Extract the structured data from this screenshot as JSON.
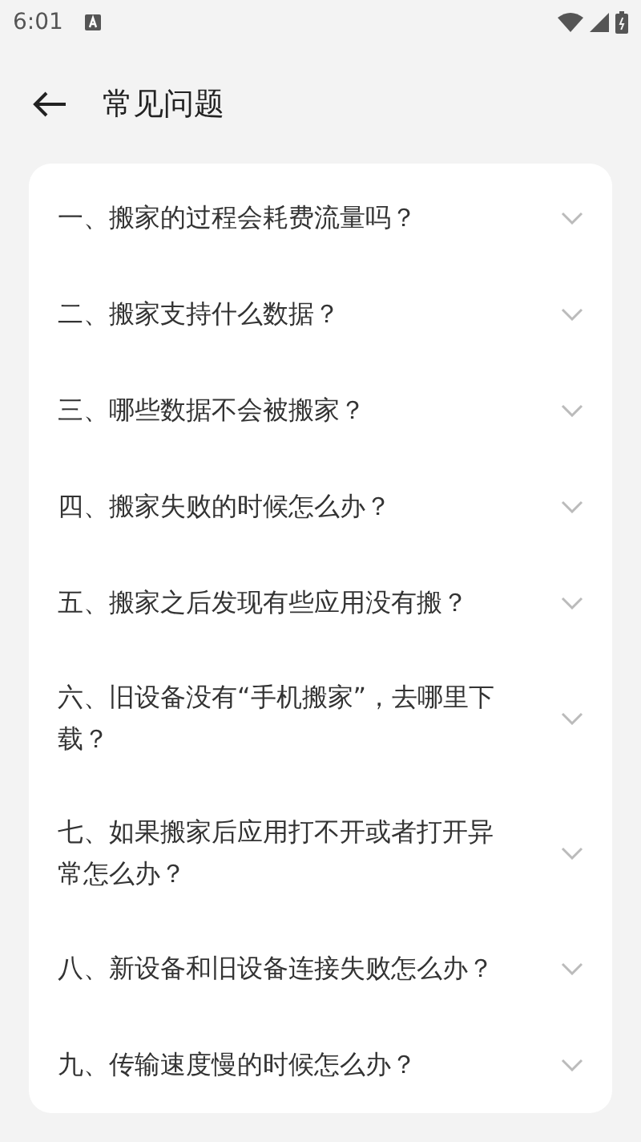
{
  "status_bar": {
    "time": "6:01"
  },
  "header": {
    "title": "常见问题"
  },
  "faq_items": [
    {
      "question": "一、搬家的过程会耗费流量吗？"
    },
    {
      "question": "二、搬家支持什么数据？"
    },
    {
      "question": "三、哪些数据不会被搬家？"
    },
    {
      "question": "四、搬家失败的时候怎么办？"
    },
    {
      "question": "五、搬家之后发现有些应用没有搬？"
    },
    {
      "question": "六、旧设备没有“手机搬家”，去哪里下载？"
    },
    {
      "question": "七、如果搬家后应用打不开或者打开异常怎么办？"
    },
    {
      "question": "八、新设备和旧设备连接失败怎么办？"
    },
    {
      "question": "九、传输速度慢的时候怎么办？"
    }
  ]
}
